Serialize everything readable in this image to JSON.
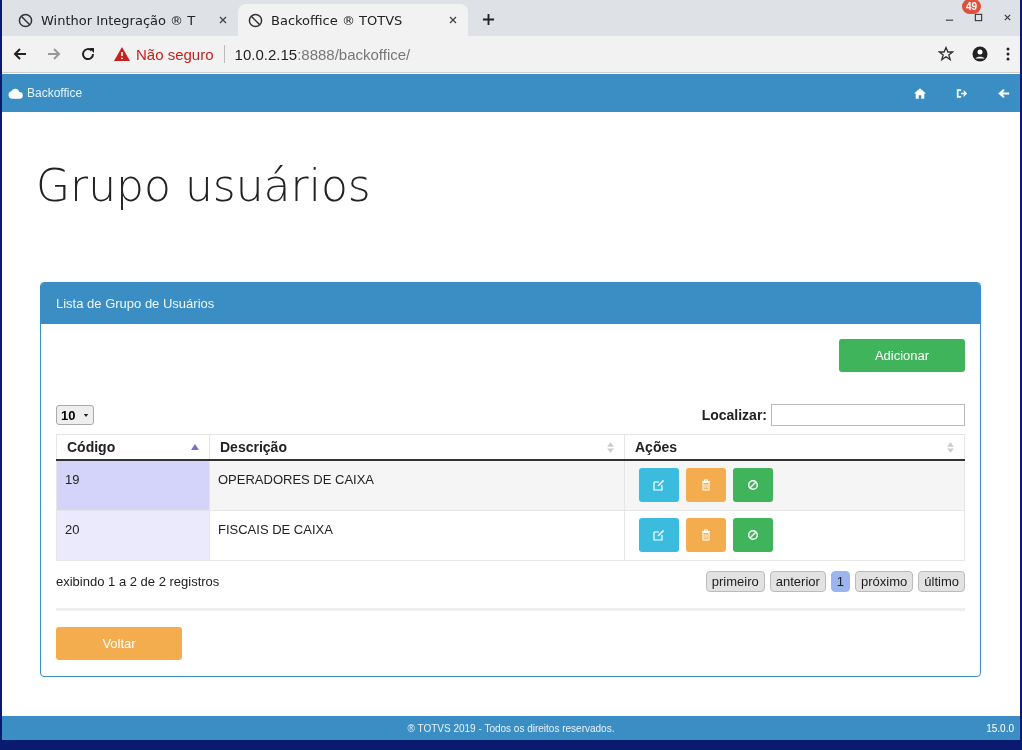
{
  "browser": {
    "tabs": [
      {
        "title": "Winthor Integração ® T",
        "selected": false
      },
      {
        "title": "Backoffice ® TOTVS",
        "selected": true
      }
    ],
    "badge": "49",
    "address": {
      "warning": "Não seguro",
      "host": "10.0.2.15",
      "path": ":8888/backoffice/"
    }
  },
  "navbar": {
    "brand": "Backoffice"
  },
  "page_title": "Grupo usuários",
  "panel": {
    "title": "Lista de Grupo de Usuários",
    "add_button": "Adicionar",
    "page_length": "10",
    "search_label": "Localizar:",
    "columns": [
      {
        "label": "Código",
        "sorted": true
      },
      {
        "label": "Descrição",
        "sorted": false
      },
      {
        "label": "Ações",
        "sorted": false
      }
    ],
    "rows": [
      {
        "code": "19",
        "description": "OPERADORES DE CAIXA"
      },
      {
        "code": "20",
        "description": "FISCAIS DE CAIXA"
      }
    ],
    "info": "exibindo 1 a 2 de 2 registros",
    "pagination": [
      {
        "label": "primeiro",
        "selected": false
      },
      {
        "label": "anterior",
        "selected": false
      },
      {
        "label": "1",
        "selected": true
      },
      {
        "label": "próximo",
        "selected": false
      },
      {
        "label": "último",
        "selected": false
      }
    ],
    "back_button": "Voltar"
  },
  "footer": {
    "text": "® TOTVS 2019 - Todos os direitos reservados.",
    "version": "15.0.0"
  }
}
